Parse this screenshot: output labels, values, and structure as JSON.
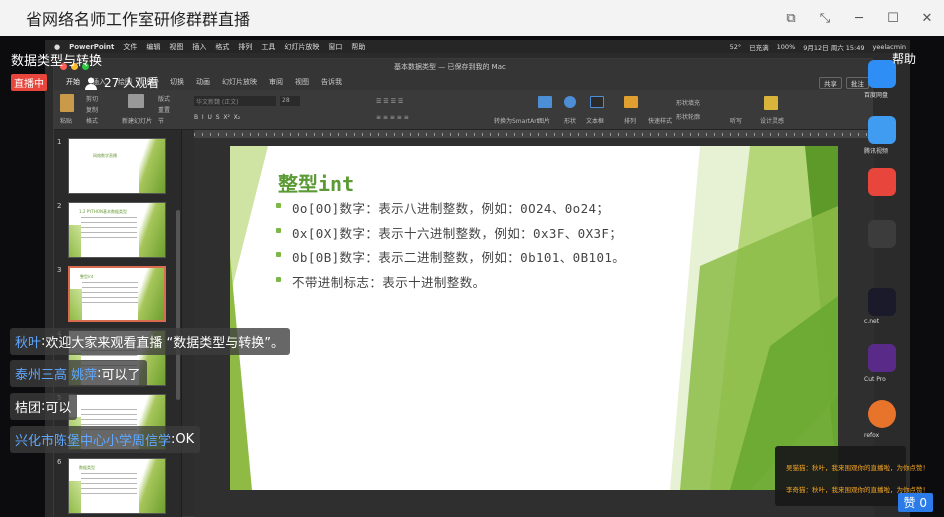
{
  "window": {
    "title": "省网络名师工作室研修群群直播",
    "controls": [
      "⧉",
      "⤡",
      "─",
      "☐",
      "✕"
    ]
  },
  "live": {
    "title": "数据类型与转换",
    "badge": "直播中",
    "viewers": "27 人观看",
    "help": "帮助",
    "likes": "赞 0"
  },
  "mac": {
    "app": "PowerPoint",
    "menus": [
      "文件",
      "编辑",
      "视图",
      "插入",
      "格式",
      "排列",
      "工具",
      "幻灯片放映",
      "窗口",
      "帮助"
    ],
    "status_right": [
      "52°",
      "已充满",
      "100%",
      "9月12日 周六 15:49",
      "yeelacmin"
    ]
  },
  "ppt": {
    "doc_title": "基本数据类型 — 已保存到我的 Mac",
    "tabs": [
      "开始",
      "插入",
      "绘图",
      "设计",
      "切换",
      "动画",
      "幻灯片放映",
      "审阅",
      "视图",
      "告诉我"
    ],
    "share": "共享",
    "comment": "批注",
    "ribbon": {
      "paste": "粘贴",
      "cut": "剪切",
      "copy": "复制",
      "format": "格式",
      "new_slide": "新建幻灯片",
      "layout": "版式",
      "reset": "重置",
      "section": "节",
      "font_name": "华文新魏 (正文)",
      "font_size": "28",
      "smartart": "转换为SmartArt",
      "picture": "图片",
      "shape": "形状",
      "textbox": "文本框",
      "arrange": "排列",
      "quick_styles": "快速样式",
      "shape_fill": "形状填充",
      "shape_outline": "形状轮廓",
      "dictate": "听写",
      "design_ideas": "设计灵感"
    },
    "thumbnails": [
      {
        "num": "1",
        "title": "网络数学直播"
      },
      {
        "num": "2",
        "title": "1.2 PYTHON基本数据类型"
      },
      {
        "num": "3",
        "title": "整型int"
      },
      {
        "num": "4",
        "title": ""
      },
      {
        "num": "5",
        "title": ""
      },
      {
        "num": "6",
        "title": "数据类型"
      }
    ],
    "slide": {
      "title": "整型int",
      "bullets": [
        "0o[0O]数字：表示八进制整数，例如：0O24、0o24；",
        "0x[0X]数字：表示十六进制整数，例如：0x3F、0X3F；",
        "0b[0B]数字：表示二进制整数，例如：0b101、0B101。",
        "不带进制标志：表示十进制整数。"
      ]
    }
  },
  "chat": [
    {
      "name": "秋叶",
      "sep": ":",
      "text": "欢迎大家来观看直播 “数据类型与转换”。"
    },
    {
      "name": "泰州三高 姚萍",
      "sep": ":",
      "text": "可以了"
    },
    {
      "name": "桔团",
      "sep": ":",
      "text": "可以"
    },
    {
      "name": "兴化市陈堡中心小学周信学",
      "sep": ":",
      "text": "OK"
    }
  ],
  "notification": [
    "吴猫猫：秋叶，我来围观你的直播啦，为你点赞！",
    "李奇猫：秋叶，我来围观你的直播啦，为你点赞！"
  ],
  "dock_labels": [
    "百度网盘",
    "腾讯视频",
    "c.net",
    "Cut Pro",
    "refox"
  ],
  "colors": {
    "slide_green": "#5b9a35",
    "accent_green": "#7db847",
    "chat_name_blue": "#5fa8ff",
    "live_red": "#e8453c",
    "like_blue": "#2b7be8"
  }
}
